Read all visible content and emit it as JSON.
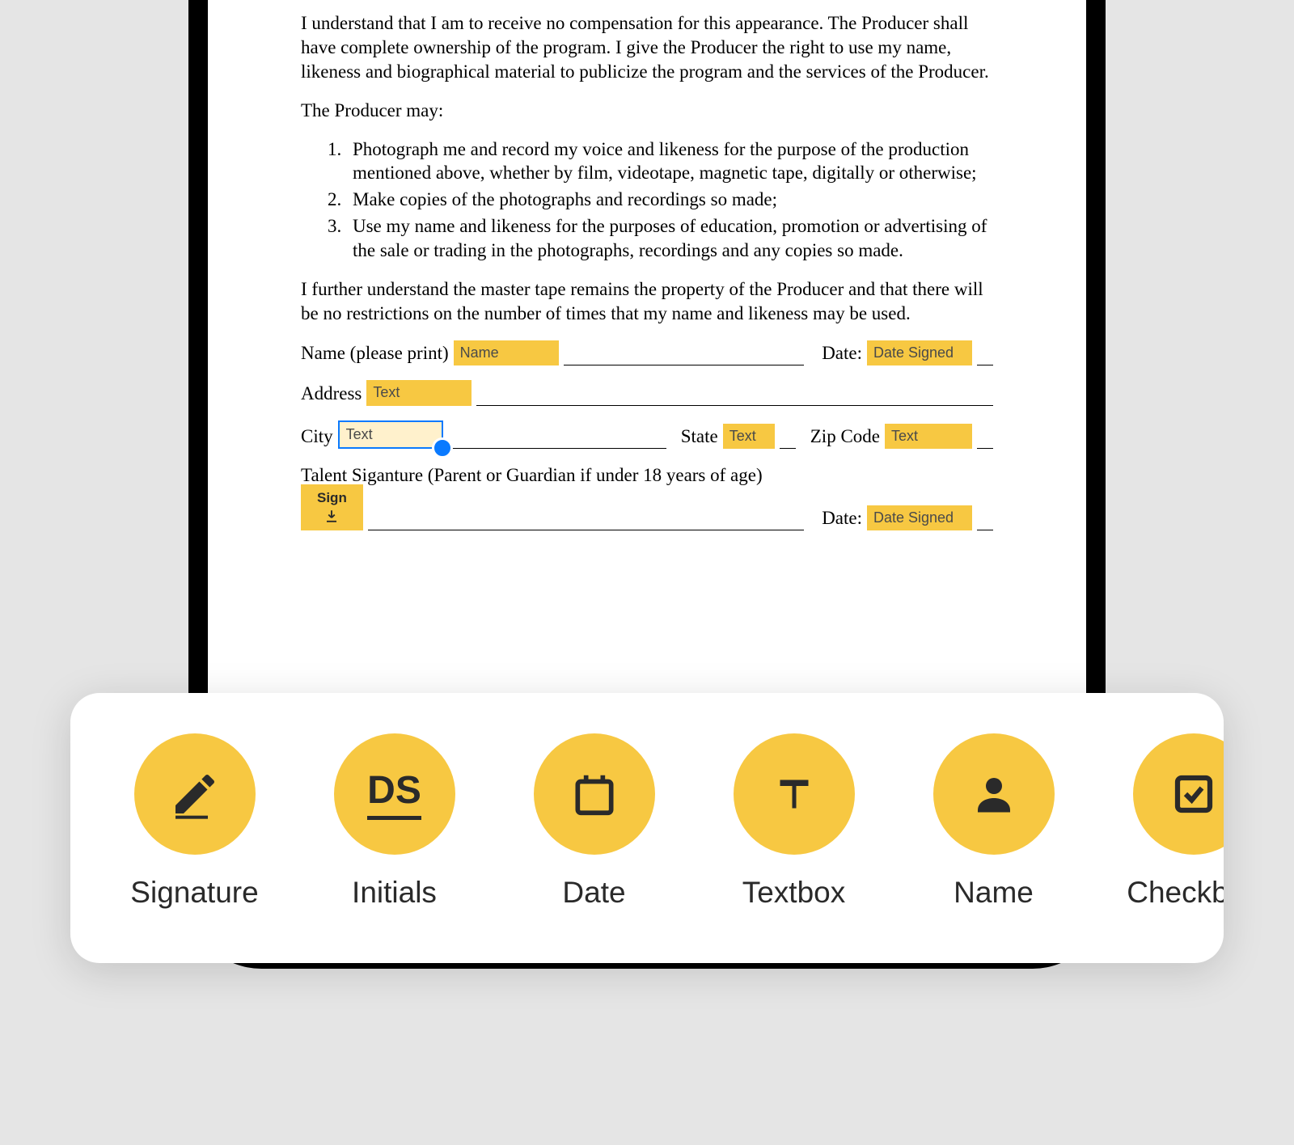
{
  "document": {
    "paragraph1": "I understand that I am to receive no compensation for this appearance. The Producer shall have complete ownership of the program. I give the Producer the right to use my name, likeness and biographical material to publicize the program and the services of the Producer.",
    "paragraph2_intro": "The Producer may:",
    "list_items": [
      "Photograph me and record my voice and likeness for the purpose of the production mentioned above, whether by film, videotape, magnetic tape, digitally or otherwise;",
      "Make copies of the photographs and recordings so made;",
      "Use my name and likeness for the purposes of education, promotion or advertising of the sale or trading in the photographs, recordings and any copies so made."
    ],
    "paragraph3": "I further understand the master tape remains the property of the Producer and that there will be no restrictions on the number of times that my name and likeness may be used.",
    "labels": {
      "name_print": "Name (please print)",
      "date": "Date:",
      "address": "Address",
      "city": "City",
      "state": "State",
      "zip": "Zip Code",
      "signature": "Talent Siganture (Parent or Guardian if under 18 years of age)"
    },
    "field_tags": {
      "name": "Name",
      "date_signed": "Date Signed",
      "text": "Text",
      "sign": "Sign"
    }
  },
  "toolbar": {
    "items": [
      {
        "id": "signature",
        "label": "Signature"
      },
      {
        "id": "initials",
        "label": "Initials",
        "text": "DS"
      },
      {
        "id": "date",
        "label": "Date"
      },
      {
        "id": "textbox",
        "label": "Textbox"
      },
      {
        "id": "name",
        "label": "Name"
      },
      {
        "id": "checkbox",
        "label": "Checkbox"
      }
    ]
  },
  "colors": {
    "accent": "#f7c842",
    "selection": "#0a7aff"
  }
}
